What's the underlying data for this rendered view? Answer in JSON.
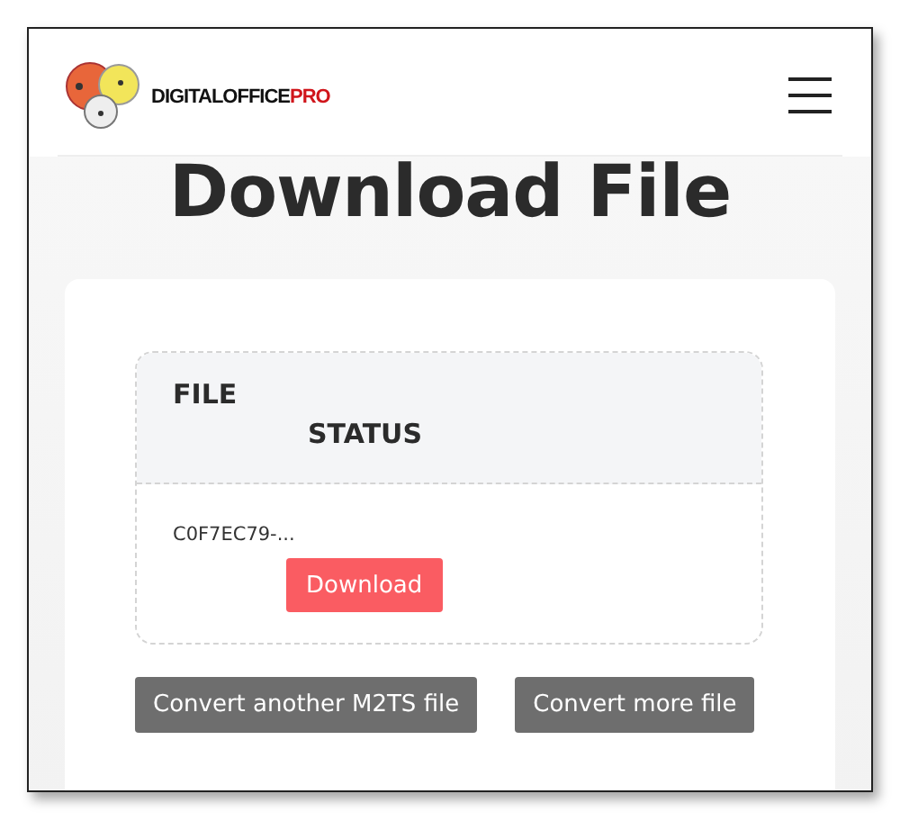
{
  "header": {
    "brand": [
      "DIGITALOFFICE",
      "PRO"
    ]
  },
  "title": "Download File",
  "table": {
    "columns": [
      "FILE",
      "STATUS"
    ],
    "rows": [
      {
        "file": "C0F7EC79-...",
        "action": "Download"
      }
    ]
  },
  "buttons": [
    "Convert another M2TS file",
    "Convert more file"
  ]
}
